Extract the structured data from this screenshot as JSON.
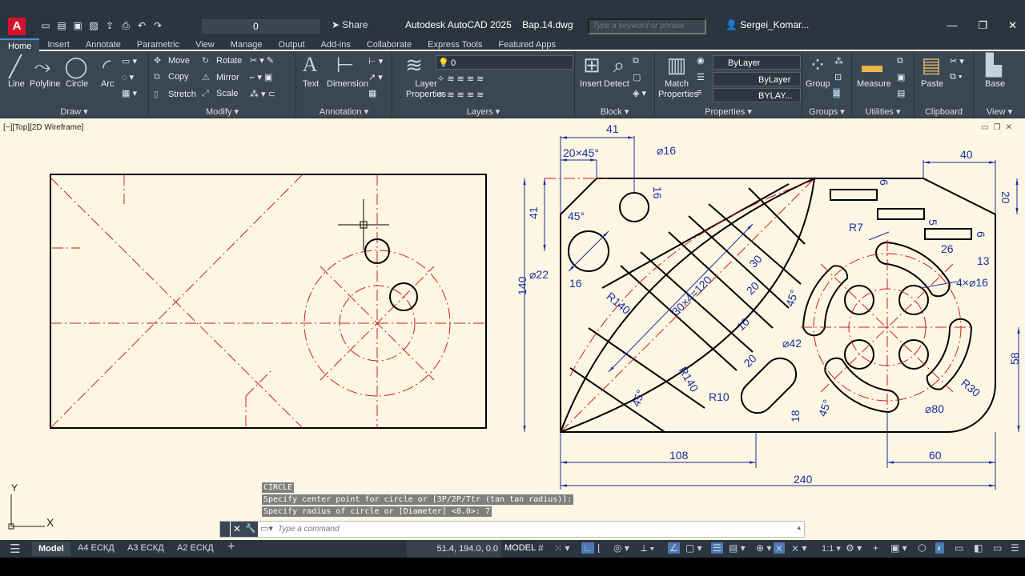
{
  "app": {
    "title": "Autodesk AutoCAD 2025",
    "file": "Вар.14.dwg",
    "share": "Share",
    "search_placeholder": "Type a keyword or phrase",
    "user": "Sergei_Komar...",
    "layer_current": "0"
  },
  "ribbon_tabs": [
    "Home",
    "Insert",
    "Annotate",
    "Parametric",
    "View",
    "Manage",
    "Output",
    "Add-ins",
    "Collaborate",
    "Express Tools",
    "Featured Apps"
  ],
  "panels": {
    "draw": {
      "title": "Draw",
      "line": "Line",
      "polyline": "Polyline",
      "circle": "Circle",
      "arc": "Arc"
    },
    "modify": {
      "title": "Modify",
      "move": "Move",
      "rotate": "Rotate",
      "copy": "Copy",
      "mirror": "Mirror",
      "stretch": "Stretch",
      "scale": "Scale"
    },
    "annotation": {
      "title": "Annotation",
      "text": "Text",
      "dimension": "Dimension"
    },
    "layers": {
      "title": "Layers",
      "layer_properties": "Layer Properties",
      "layer_value": "0"
    },
    "block": {
      "title": "Block",
      "insert": "Insert",
      "detect": "Detect"
    },
    "properties": {
      "title": "Properties",
      "match": "Match Properties",
      "color": "ByLayer",
      "linetype": "ByLayer",
      "lineweight": "BYLAY..."
    },
    "groups": {
      "title": "Groups",
      "group": "Group"
    },
    "utilities": {
      "title": "Utilities",
      "measure": "Measure"
    },
    "clipboard": {
      "title": "Clipboard",
      "paste": "Paste"
    },
    "view": {
      "title": "View",
      "base": "Base"
    }
  },
  "viewport": {
    "label": "[−][Top][2D Wireframe]"
  },
  "dims": {
    "d41": "41",
    "d20x45": "20×45°",
    "d16a": "⌀16",
    "d16b": "16",
    "d40": "40",
    "d20": "20",
    "d6a": "6",
    "d6b": "6",
    "d5": "5",
    "d26": "26",
    "d13": "13",
    "d4x16": "4×⌀16",
    "dR7": "R7",
    "d41v": "41",
    "d45a": "45°",
    "d22": "⌀22",
    "d16c": "16",
    "d140": "140",
    "d30": "30",
    "d20b": "20",
    "d30x4": "30×4=120",
    "d10": "10",
    "d45b": "45°",
    "dR140a": "R140",
    "dR140b": "R140",
    "d42": "⌀42",
    "d20c": "20",
    "d45c": "45°",
    "dR10": "R10",
    "d18": "18",
    "d45d": "45°",
    "d80": "⌀80",
    "dR30": "R30",
    "d58": "58",
    "d108": "108",
    "d60": "60",
    "d240": "240"
  },
  "command": {
    "history": [
      "CIRCLE",
      "Specify center point for circle or [3P/2P/Ttr (tan tan radius)]:",
      "Specify radius of circle or [Diameter] <8.0>: 7"
    ],
    "placeholder": "Type a command"
  },
  "status": {
    "layouts": [
      "Model",
      "А4 ЕСКД",
      "А3 ЕСКД",
      "А2 ЕСКД"
    ],
    "coords": "51.4, 194.0, 0.0",
    "space": "MODEL",
    "scale": "1:1"
  },
  "colors": {
    "background": "#fcf6e3",
    "geometry": "#000000",
    "center_lines": "#cc1f1f",
    "dimensions": "#1a2fa0",
    "ribbon": "#3b4653"
  }
}
